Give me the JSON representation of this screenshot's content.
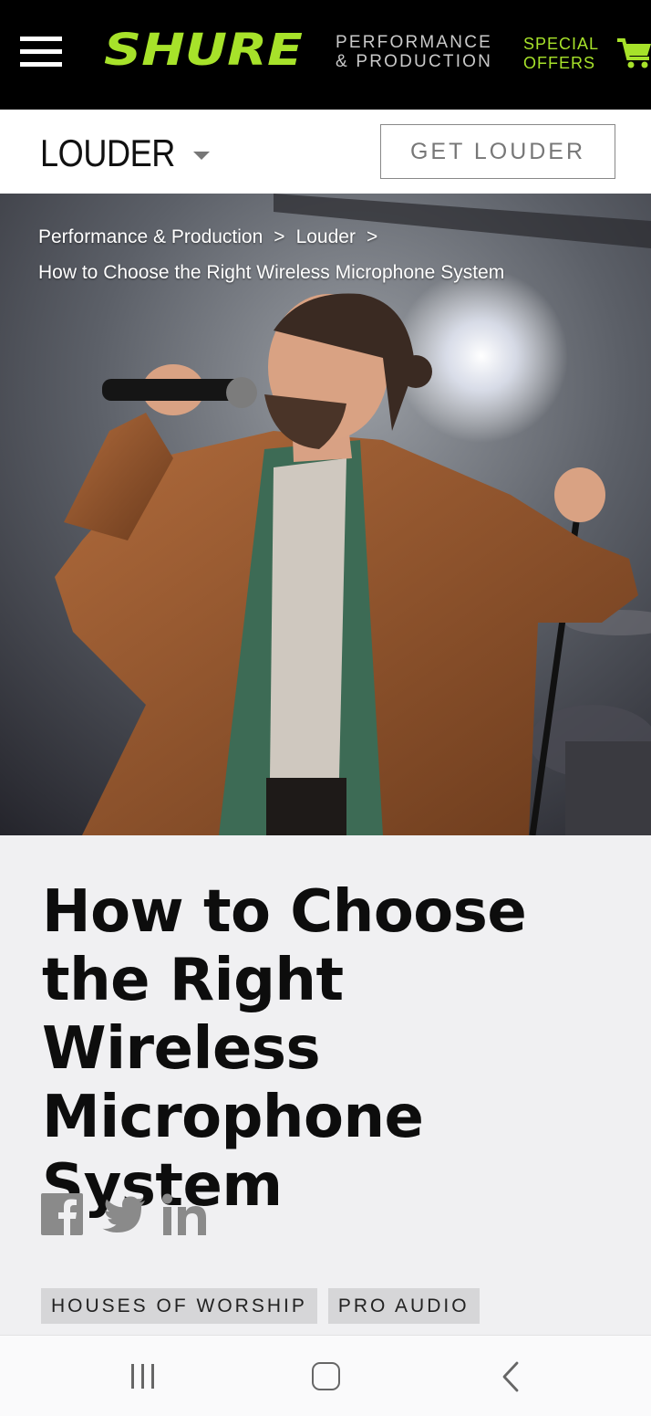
{
  "header": {
    "menu_icon": "hamburger-menu-icon",
    "logo_text": "SHURE",
    "section_line1": "PERFORMANCE",
    "section_line2": "& PRODUCTION",
    "special_line1": "SPECIAL",
    "special_line2": "OFFERS",
    "cart_icon": "shopping-cart-icon",
    "brand_color": "#a7e22a"
  },
  "subnav": {
    "title": "LOUDER",
    "dropdown_icon": "caret-down-icon",
    "cta_label": "GET LOUDER"
  },
  "breadcrumb": {
    "items": [
      "Performance & Production",
      "Louder",
      "How to Choose the Right Wireless Microphone System"
    ],
    "separator": ">"
  },
  "article": {
    "title": "How to Choose the Right Wireless Microphone System",
    "share_icons": [
      "facebook-icon",
      "twitter-icon",
      "linkedin-icon"
    ],
    "tags": [
      "HOUSES OF WORSHIP",
      "PRO AUDIO"
    ]
  },
  "system_nav": {
    "recent_icon": "recent-apps-icon",
    "home_icon": "home-icon",
    "back_icon": "back-icon"
  }
}
